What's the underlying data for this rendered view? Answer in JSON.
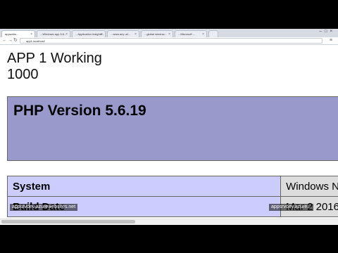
{
  "browser": {
    "tabs": [
      {
        "label": "appwebs..."
      },
      {
        "label": "...Windows app 5.6..."
      },
      {
        "label": "...Application Insights..."
      },
      {
        "label": "...www.any url..."
      },
      {
        "label": "...global window..."
      },
      {
        "label": "...Microsoft ..."
      },
      {
        "label": ""
      }
    ],
    "url": "app1.localhost/"
  },
  "page": {
    "app_title": "APP 1 Working",
    "app_count": "1000",
    "php_version": "PHP Version 5.6.19",
    "table": [
      {
        "key": "System",
        "value": "Windows N"
      },
      {
        "key": "Build Date",
        "value": "Mar 2 2016"
      }
    ]
  },
  "watermarks": {
    "left": "appsrvdev.azurewebsites.net",
    "right": "appsrvdev.azure..."
  }
}
